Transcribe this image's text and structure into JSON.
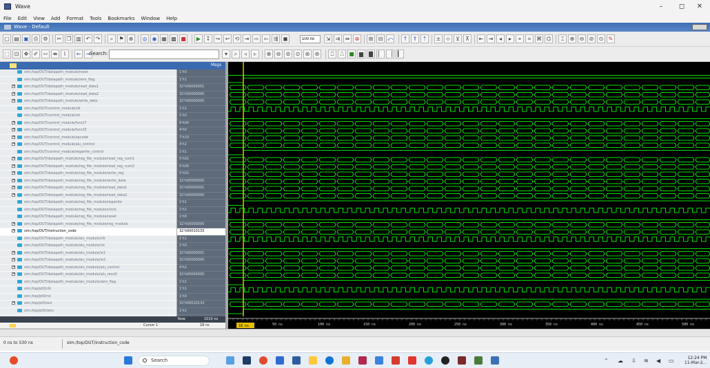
{
  "titlebar": {
    "title": "Wave",
    "min": "–",
    "max": "◻",
    "close": "✕"
  },
  "menu": [
    "File",
    "Edit",
    "View",
    "Add",
    "Format",
    "Tools",
    "Bookmarks",
    "Window",
    "Help"
  ],
  "wave_header": {
    "title": "Wave - Default"
  },
  "toolbar": {
    "search_label": "Search:",
    "search_value": "",
    "sim_time": "100 ns"
  },
  "list_header": {
    "msgs_label": "Msgs"
  },
  "signals": [
    {
      "name": "sim:/top/DUT/datapath_module/reset",
      "value": "1'h0",
      "kind": "bit",
      "expand": false
    },
    {
      "name": "sim:/top/DUT/datapath_module/zero_flag",
      "value": "1'h1",
      "kind": "bit",
      "expand": false
    },
    {
      "name": "sim:/top/DUT/datapath_module/read_data1",
      "value": "32'h00000001",
      "kind": "bus",
      "expand": true
    },
    {
      "name": "sim:/top/DUT/datapath_module/read_data2",
      "value": "32'h00000000",
      "kind": "bus",
      "expand": true
    },
    {
      "name": "sim:/top/DUT/datapath_module/write_data",
      "value": "32'h00000000",
      "kind": "bus",
      "expand": true
    },
    {
      "name": "sim:/top/DUT/control_module/clk",
      "value": "1'h1",
      "kind": "clk",
      "expand": false
    },
    {
      "name": "sim:/top/DUT/control_module/rst",
      "value": "1'h0",
      "kind": "bit",
      "expand": false
    },
    {
      "name": "sim:/top/DUT/control_module/funct7",
      "value": "6'h00",
      "kind": "bus",
      "expand": true
    },
    {
      "name": "sim:/top/DUT/control_module/funct3",
      "value": "4'h0",
      "kind": "bus",
      "expand": true
    },
    {
      "name": "sim:/top/DUT/control_module/opcode",
      "value": "7'h33",
      "kind": "bus",
      "expand": true
    },
    {
      "name": "sim:/top/DUT/control_module/alu_control",
      "value": "4'h2",
      "kind": "bus",
      "expand": true
    },
    {
      "name": "sim:/top/DUT/control_module/regwrite_control",
      "value": "1'h1",
      "kind": "bit",
      "expand": false
    },
    {
      "name": "sim:/top/DUT/datapath_module/reg_file_module/read_reg_num1",
      "value": "5'h01",
      "kind": "bus",
      "expand": true
    },
    {
      "name": "sim:/top/DUT/datapath_module/reg_file_module/read_reg_num2",
      "value": "5'h00",
      "kind": "bus",
      "expand": true
    },
    {
      "name": "sim:/top/DUT/datapath_module/reg_file_module/write_reg",
      "value": "5'h02",
      "kind": "bus",
      "expand": true
    },
    {
      "name": "sim:/top/DUT/datapath_module/reg_file_module/write_data",
      "value": "32'h00000000",
      "kind": "bus",
      "expand": true
    },
    {
      "name": "sim:/top/DUT/datapath_module/reg_file_module/read_data1",
      "value": "32'h00000001",
      "kind": "bus",
      "expand": true
    },
    {
      "name": "sim:/top/DUT/datapath_module/reg_file_module/read_data2",
      "value": "32'h00000000",
      "kind": "bus",
      "expand": true
    },
    {
      "name": "sim:/top/DUT/datapath_module/reg_file_module/regwrite",
      "value": "1'h1",
      "kind": "bit",
      "expand": false
    },
    {
      "name": "sim:/top/DUT/datapath_module/reg_file_module/clock",
      "value": "1'h1",
      "kind": "clk",
      "expand": false
    },
    {
      "name": "sim:/top/DUT/datapath_module/reg_file_module/reset",
      "value": "1'h0",
      "kind": "bit",
      "expand": false
    },
    {
      "name": "sim:/top/DUT/datapath_module/reg_file_module/reg_module",
      "value": "32'h00000000",
      "kind": "bus",
      "expand": true
    },
    {
      "name": "sim:/top/DUT/instruction_code",
      "value": "32'h00010133",
      "kind": "bus",
      "expand": true,
      "selected": true
    },
    {
      "name": "sim:/top/DUT/datapath_module/alu_module/clk",
      "value": "1'h1",
      "kind": "clk",
      "expand": false
    },
    {
      "name": "sim:/top/DUT/datapath_module/alu_module/rst",
      "value": "1'h0",
      "kind": "bit",
      "expand": false
    },
    {
      "name": "sim:/top/DUT/datapath_module/alu_module/in1",
      "value": "32'h00000001",
      "kind": "bus",
      "expand": true
    },
    {
      "name": "sim:/top/DUT/datapath_module/alu_module/in2",
      "value": "32'h00000000",
      "kind": "bus",
      "expand": true
    },
    {
      "name": "sim:/top/DUT/datapath_module/alu_module/alu_control",
      "value": "4'h2",
      "kind": "bus",
      "expand": true
    },
    {
      "name": "sim:/top/DUT/datapath_module/alu_module/alu_result",
      "value": "32'h00000000",
      "kind": "bus",
      "expand": true
    },
    {
      "name": "sim:/top/DUT/datapath_module/alu_module/zero_flag",
      "value": "1'h1",
      "kind": "bit",
      "expand": false
    },
    {
      "name": "sim:/top/pt0/clk",
      "value": "1'h1",
      "kind": "clk",
      "expand": false
    },
    {
      "name": "sim:/top/pt0/rst",
      "value": "1'h0",
      "kind": "bit",
      "expand": false
    },
    {
      "name": "sim:/top/pt0/out",
      "value": "32'h00010133",
      "kind": "bus",
      "expand": true
    },
    {
      "name": "sim:/top/pt0/zero",
      "value": "1'h1",
      "kind": "bit",
      "expand": false
    }
  ],
  "now": {
    "label": "Now",
    "value": "1010 ns"
  },
  "cursor": {
    "label": "Cursor 1",
    "value": "18 ns",
    "marker": "18 ns"
  },
  "time_ticks": [
    "50 ns",
    "100 ns",
    "150 ns",
    "200 ns",
    "250 ns",
    "300 ns",
    "350 ns",
    "400 ns",
    "450 ns",
    "500 ns"
  ],
  "status": {
    "range": "0 ns to 530 ns",
    "path": "sim:/top/DUT/instruction_code"
  },
  "taskbar": {
    "search_label": "Search",
    "time": "12:24 PM",
    "date": "11-Mar-2..."
  },
  "colors": {
    "wave": "#00e000",
    "cursor": "#e8c000",
    "selected_row": "#ffffff",
    "value_text": "#ffffff"
  }
}
